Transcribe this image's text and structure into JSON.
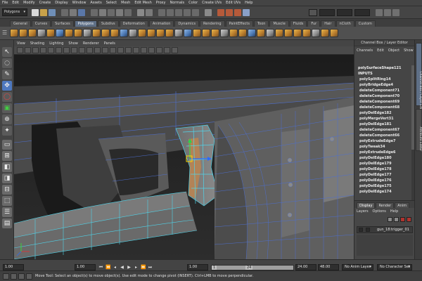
{
  "menubar": {
    "items": [
      "File",
      "Edit",
      "Modify",
      "Create",
      "Display",
      "Window",
      "Assets",
      "Select",
      "Mesh",
      "Edit Mesh",
      "Proxy",
      "Normals",
      "Color",
      "Create UVs",
      "Edit UVs",
      "Help"
    ]
  },
  "statusline": {
    "mode": "Polygons"
  },
  "shelf": {
    "tabs": [
      "General",
      "Curves",
      "Surfaces",
      "Polygons",
      "Subdivs",
      "Deformation",
      "Animation",
      "Dynamics",
      "Rendering",
      "PaintEffects",
      "Toon",
      "Muscle",
      "Fluids",
      "Fur",
      "Hair",
      "nCloth",
      "Custom"
    ],
    "active_tab": "Polygons"
  },
  "viewport": {
    "menu": [
      "View",
      "Shading",
      "Lighting",
      "Show",
      "Renderer",
      "Panels"
    ]
  },
  "channel_box": {
    "title": "Channel Box / Layer Editor",
    "menu": [
      "Channels",
      "Edit",
      "Object",
      "Show"
    ],
    "shape": "polySurfaceShape121",
    "inputs_label": "INPUTS",
    "nodes": [
      "polySplitRing14",
      "polyBridgeEdge4",
      "deleteComponent71",
      "deleteComponent70",
      "deleteComponent69",
      "deleteComponent68",
      "polyDelEdge182",
      "polyMergeVert31",
      "polyDelEdge181",
      "deleteComponent67",
      "deleteComponent66",
      "polyExtrudeEdge7",
      "polyTweak34",
      "polyExtrudeEdge6",
      "polyDelEdge180",
      "polyDelEdge179",
      "polyDelEdge178",
      "polyDelEdge177",
      "polyDelEdge176",
      "polyDelEdge175",
      "polyDelEdge174"
    ]
  },
  "layer_editor": {
    "tabs": [
      "Display",
      "Render",
      "Anim"
    ],
    "active_tab": "Display",
    "menu": [
      "Layers",
      "Options",
      "Help"
    ],
    "layer_name": "gun_18:trigger_01"
  },
  "side_tabs": [
    "Channel Box / Layer Editor",
    "Attribute Editor"
  ],
  "timeline": {
    "start_time": "1.00",
    "playback_start": "1.00",
    "range_start": "1.00",
    "range_marker_left": "1",
    "range_marker_right": "24",
    "playback_end": "24.00",
    "end_time": "48.00",
    "anim_layer": "No Anim Layer",
    "character_set": "No Character Set"
  },
  "helpline": {
    "text": "Move Tool: Select an object(s) to move object(s). Use edit mode to change pivot (INSERT). Ctrl+LMB to move perpendicular."
  },
  "colors": {
    "wire": "#4d6fd1",
    "wire_selected": "#4fd4ea",
    "accent": "#5e6f86"
  }
}
